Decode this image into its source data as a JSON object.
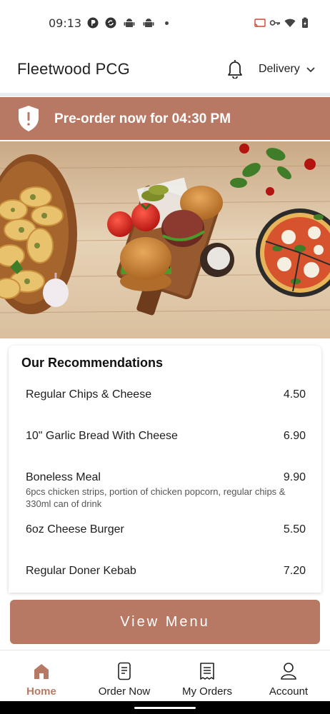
{
  "status_bar": {
    "time": "09:13"
  },
  "header": {
    "store_name": "Fleetwood PCG",
    "mode": "Delivery"
  },
  "banner": {
    "text": "Pre-order now for 04:30 PM"
  },
  "recommendations": {
    "title": "Our Recommendations",
    "items": [
      {
        "name": "Regular Chips & Cheese",
        "price": "4.50",
        "description": ""
      },
      {
        "name": "10\" Garlic Bread With Cheese",
        "price": "6.90",
        "description": ""
      },
      {
        "name": "Boneless Meal",
        "price": "9.90",
        "description": "6pcs chicken strips, portion of chicken popcorn, regular chips & 330ml can of drink"
      },
      {
        "name": "6oz Cheese Burger",
        "price": "5.50",
        "description": ""
      },
      {
        "name": "Regular Doner Kebab",
        "price": "7.20",
        "description": ""
      }
    ]
  },
  "view_menu_label": "View Menu",
  "bottom_nav": {
    "items": [
      {
        "label": "Home",
        "icon": "home-icon",
        "active": true
      },
      {
        "label": "Order Now",
        "icon": "phone-order-icon",
        "active": false
      },
      {
        "label": "My Orders",
        "icon": "receipt-icon",
        "active": false
      },
      {
        "label": "Account",
        "icon": "person-icon",
        "active": false
      }
    ]
  },
  "colors": {
    "accent": "#b77964",
    "divider": "#e7ecf1"
  }
}
